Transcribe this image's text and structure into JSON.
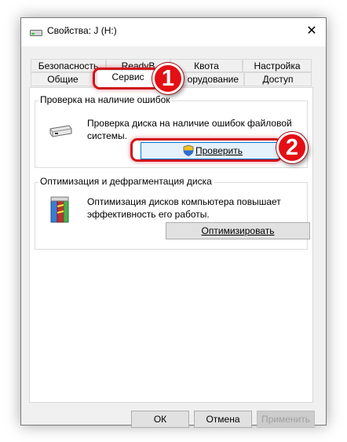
{
  "window": {
    "title": "Свойства: J (H:)",
    "close_glyph": "✕"
  },
  "tabs": {
    "back_row": [
      "Безопасность",
      "ReadyB",
      "Квота",
      "Настройка"
    ],
    "front_row": [
      "Общие",
      "Сервис",
      "орудование",
      "Доступ"
    ],
    "active": "Сервис"
  },
  "error_check": {
    "group_label": "Проверка на наличие ошибок",
    "description_line1": "Проверка диска на наличие ошибок файловой",
    "description_line2": "системы.",
    "button_label": "Проверить"
  },
  "optimize": {
    "group_label": "Оптимизация и дефрагментация диска",
    "description_line1": "Оптимизация дисков компьютера повышает",
    "description_line2": "эффективность его работы.",
    "button_label": "Оптимизировать"
  },
  "footer": {
    "ok_label": "ОК",
    "cancel_label": "Отмена",
    "apply_label": "Применить"
  },
  "annotations": {
    "step1": "1",
    "step2": "2"
  },
  "colors": {
    "annotation_red": "#e30f14",
    "focus_blue": "#0078d7"
  }
}
